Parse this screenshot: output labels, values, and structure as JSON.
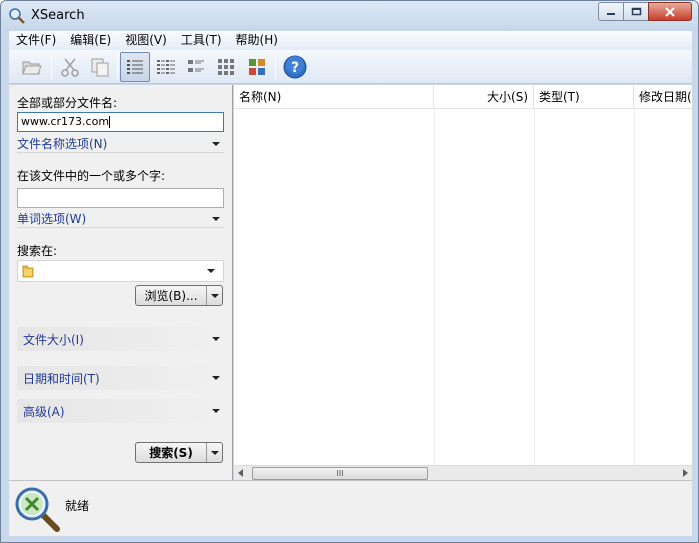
{
  "window": {
    "title": "XSearch"
  },
  "menu": [
    "文件(F)",
    "编辑(E)",
    "视图(V)",
    "工具(T)",
    "帮助(H)"
  ],
  "toolbar": {
    "icons": [
      "open-folder-icon",
      "cut-icon",
      "copy-icon",
      "details-view-icon",
      "list-view-icon",
      "small-icons-view-icon",
      "large-icons-view-icon",
      "thumbnail-view-icon",
      "help-icon"
    ],
    "active_view": "details-view-icon"
  },
  "left": {
    "filename_label": "全部或部分文件名:",
    "filename_value": "www.cr173.com",
    "filename_options": "文件名称选项(N)",
    "word_label": "在该文件中的一个或多个字:",
    "word_value": "",
    "word_options": "单词选项(W)",
    "search_in_label": "搜索在:",
    "browse_button": "浏览(B)...",
    "file_size": "文件大小(I)",
    "date_time": "日期和时间(T)",
    "advanced": "高级(A)",
    "search_button": "搜索(S)"
  },
  "results": {
    "columns": [
      "名称(N)",
      "大小(S)",
      "类型(T)",
      "修改日期(M)"
    ],
    "scroll_grip": "III"
  },
  "status": {
    "text": "就绪"
  },
  "colors": {
    "link_blue": "#1f3a93",
    "help_blue": "#2f6fc8",
    "close_red": "#c6412b"
  }
}
